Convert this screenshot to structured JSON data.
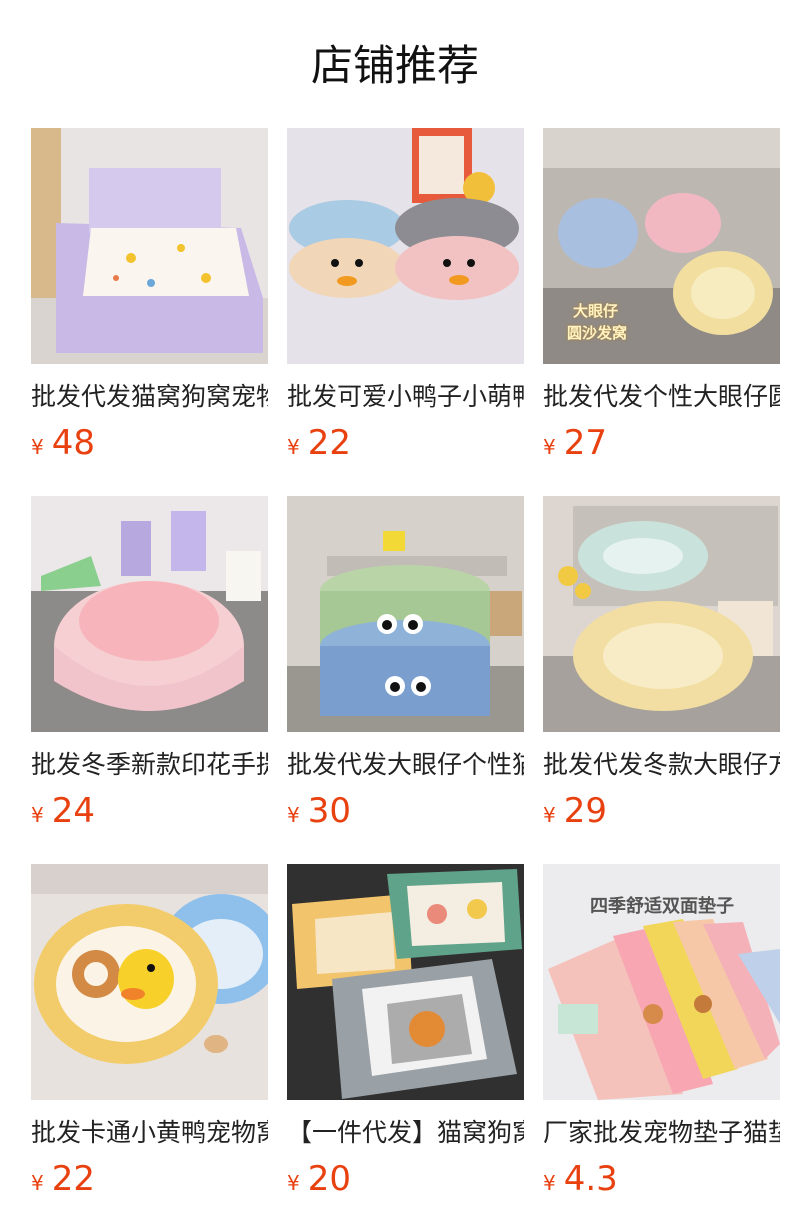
{
  "section": {
    "title": "店铺推荐"
  },
  "products": [
    {
      "name": "批发代发猫窝狗窝宠物",
      "currency": "¥",
      "price": "48"
    },
    {
      "name": "批发可爱小鸭子小萌鸭",
      "currency": "¥",
      "price": "22"
    },
    {
      "name": "批发代发个性大眼仔圆沙",
      "currency": "¥",
      "price": "27",
      "overlay_text": [
        "大眼仔",
        "圆沙发窝"
      ]
    },
    {
      "name": "批发冬季新款印花手提",
      "currency": "¥",
      "price": "24"
    },
    {
      "name": "批发代发大眼仔个性猫窝",
      "currency": "¥",
      "price": "30"
    },
    {
      "name": "批发代发冬款大眼仔方",
      "currency": "¥",
      "price": "29"
    },
    {
      "name": "批发卡通小黄鸭宠物窝",
      "currency": "¥",
      "price": "22"
    },
    {
      "name": "【一件代发】猫窝狗窝",
      "currency": "¥",
      "price": "20"
    },
    {
      "name": "厂家批发宠物垫子猫垫",
      "currency": "¥",
      "price": "4.3",
      "overlay_text": [
        "四季舒适双面垫子"
      ]
    }
  ]
}
